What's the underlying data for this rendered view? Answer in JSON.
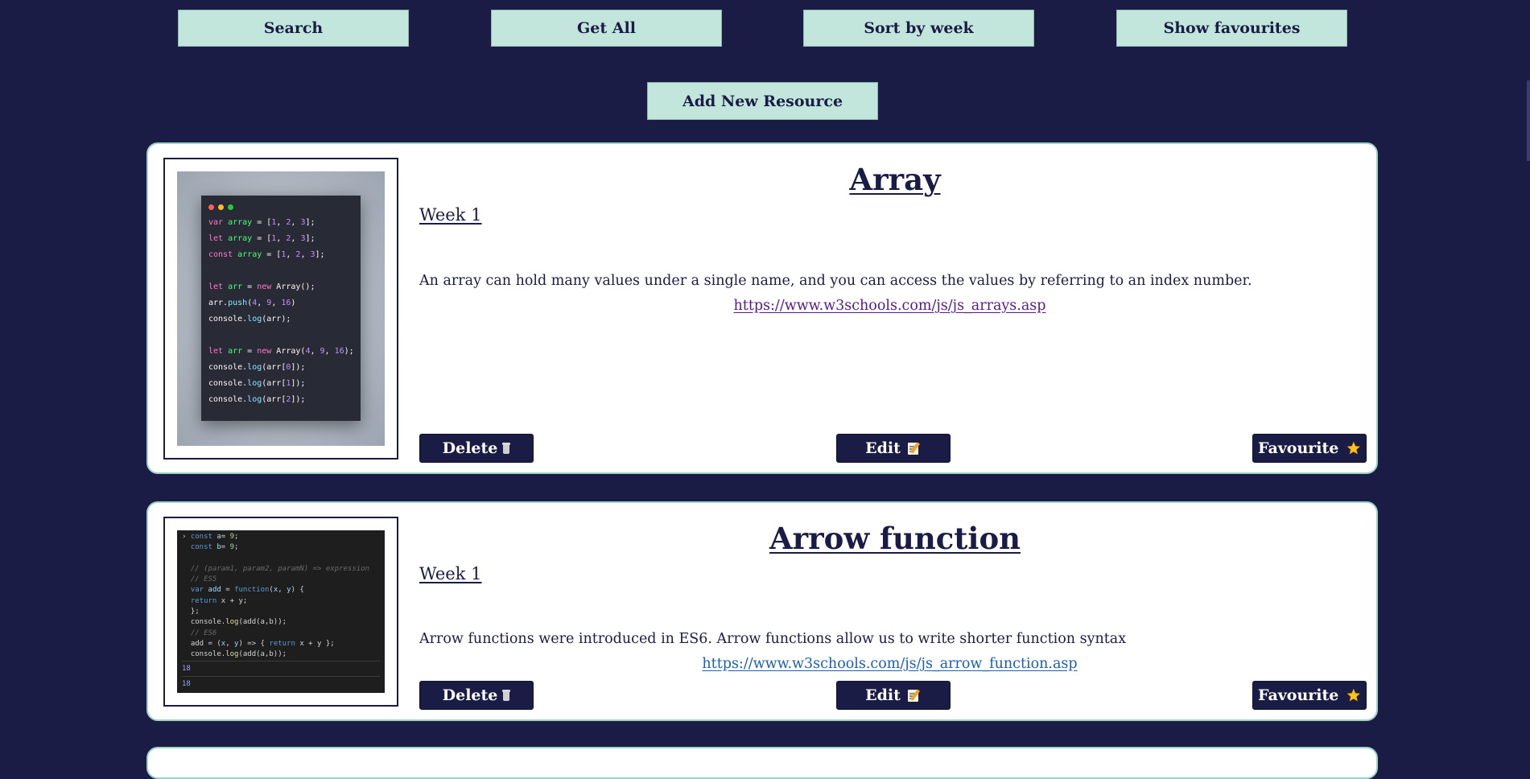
{
  "toolbar": {
    "search_label": "Search",
    "get_all_label": "Get All",
    "sort_label": "Sort by week",
    "show_fav_label": "Show favourites",
    "add_label": "Add New Resource"
  },
  "resources": [
    {
      "title": "Array",
      "week": "Week 1",
      "description": "An array can hold many values under a single name, and you can access the values by referring to an index number.",
      "url": "https://www.w3schools.com/js/js_arrays.asp",
      "delete_label": "Delete",
      "edit_label": "Edit",
      "fav_label": "Favourite",
      "code": [
        "var array = [1, 2, 3];",
        "let array = [1, 2, 3];",
        "const array = [1, 2, 3];",
        "",
        "let arr = new Array();",
        "arr.push(4, 9, 16)",
        "console.log(arr);",
        "",
        "let arr = new Array(4, 9, 16);",
        "console.log(arr[0]);",
        "console.log(arr[1]);",
        "console.log(arr[2]);"
      ]
    },
    {
      "title": "Arrow function",
      "week": "Week 1",
      "description": "Arrow functions were introduced in ES6. Arrow functions allow us to write shorter function syntax",
      "url": "https://www.w3schools.com/js/js_arrow_function.asp",
      "delete_label": "Delete",
      "edit_label": "Edit",
      "fav_label": "Favourite",
      "code": [
        "› const a= 9;",
        "  const b= 9;",
        "",
        "  // (param1, param2, paramN) => expression",
        "  // ES5",
        "  var add = function(x, y) {",
        "  return x + y;",
        "  };",
        "  console.log(add(a,b));",
        "  // ES6",
        "  add = (x, y) => { return x + y };",
        "  console.log(add(a,b));"
      ],
      "output": [
        "18",
        "18"
      ]
    }
  ],
  "colors": {
    "page_bg": "#1b1c45",
    "button_light": "#c2e6dc",
    "button_dark": "#1b1c45",
    "card_border": "#9fd2c4"
  },
  "icons": {
    "delete": "wastebasket-icon",
    "edit": "memo-icon",
    "favourite": "star-icon"
  }
}
